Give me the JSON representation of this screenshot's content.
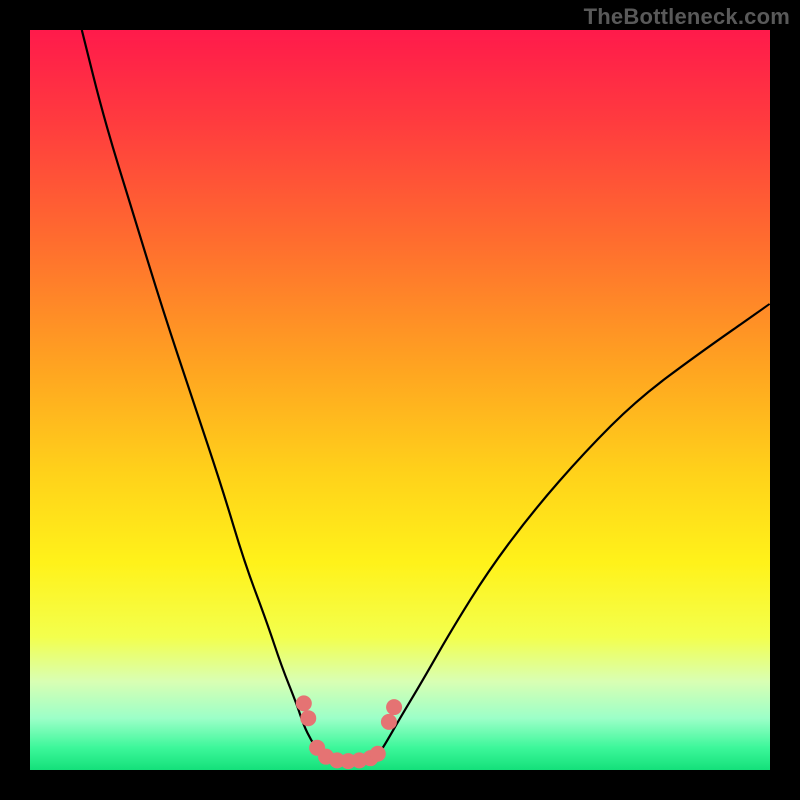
{
  "watermark": "TheBottleneck.com",
  "gradient": {
    "stops": [
      {
        "offset": "0%",
        "color": "#ff1a4b"
      },
      {
        "offset": "12%",
        "color": "#ff3a3f"
      },
      {
        "offset": "28%",
        "color": "#ff6b2f"
      },
      {
        "offset": "45%",
        "color": "#ffa221"
      },
      {
        "offset": "60%",
        "color": "#ffd21a"
      },
      {
        "offset": "72%",
        "color": "#fff21a"
      },
      {
        "offset": "82%",
        "color": "#f3ff4d"
      },
      {
        "offset": "88%",
        "color": "#d9ffb3"
      },
      {
        "offset": "93%",
        "color": "#9cffc8"
      },
      {
        "offset": "97%",
        "color": "#3cf79a"
      },
      {
        "offset": "100%",
        "color": "#14e07a"
      }
    ]
  },
  "chart_data": {
    "type": "line",
    "title": "",
    "xlabel": "",
    "ylabel": "",
    "xlim": [
      0,
      100
    ],
    "ylim": [
      0,
      100
    ],
    "series": [
      {
        "name": "left-branch",
        "x": [
          7,
          10,
          14,
          18,
          22,
          26,
          29,
          32,
          34,
          36,
          37,
          38,
          39,
          40
        ],
        "values": [
          100,
          88,
          75,
          62,
          50,
          38,
          28,
          20,
          14,
          9,
          6,
          4,
          2.5,
          1.5
        ]
      },
      {
        "name": "right-branch",
        "x": [
          47,
          48,
          50,
          53,
          57,
          62,
          68,
          75,
          82,
          90,
          100
        ],
        "values": [
          2,
          3.5,
          7,
          12,
          19,
          27,
          35,
          43,
          50,
          56,
          63
        ]
      }
    ],
    "overlays": [
      {
        "name": "green-valley-band",
        "type": "area",
        "y_range": [
          0,
          4.5
        ],
        "color": "#14e07a"
      }
    ],
    "markers": {
      "name": "pink-dots",
      "points": [
        {
          "x": 37.0,
          "y": 9.0
        },
        {
          "x": 37.6,
          "y": 7.0
        },
        {
          "x": 38.8,
          "y": 3.0
        },
        {
          "x": 40.0,
          "y": 1.8
        },
        {
          "x": 41.5,
          "y": 1.3
        },
        {
          "x": 43.0,
          "y": 1.2
        },
        {
          "x": 44.5,
          "y": 1.3
        },
        {
          "x": 46.0,
          "y": 1.6
        },
        {
          "x": 47.0,
          "y": 2.2
        },
        {
          "x": 48.5,
          "y": 6.5
        },
        {
          "x": 49.2,
          "y": 8.5
        }
      ],
      "radius": 8,
      "color": "#e57373"
    }
  }
}
